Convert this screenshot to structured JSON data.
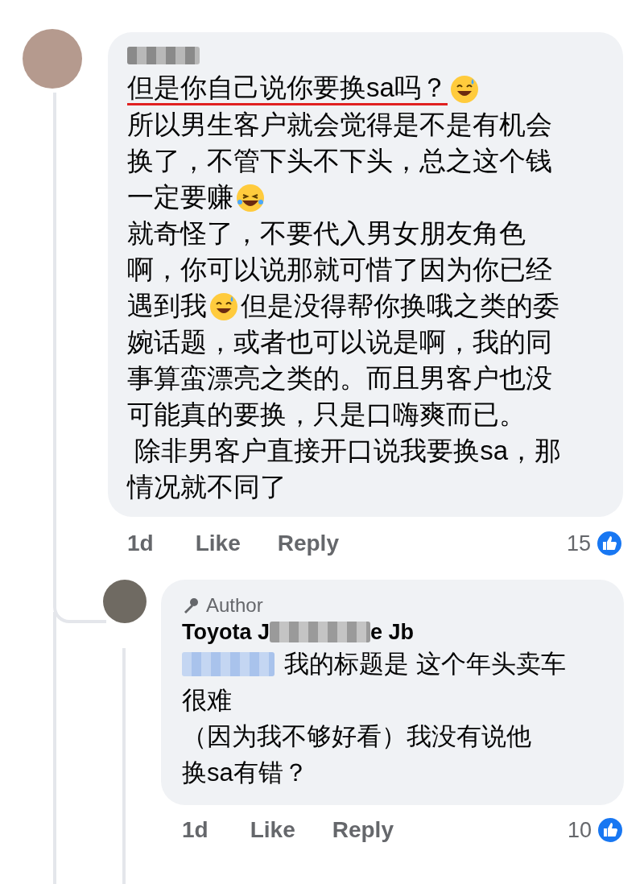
{
  "comment": {
    "body": [
      [
        {
          "kind": "text",
          "text": "但是你自己说你要换sa吗？",
          "underlined": true
        },
        {
          "kind": "emoji-sweat"
        }
      ],
      [
        {
          "kind": "text",
          "text": "所以男生客户就会觉得是不是有机会",
          "underlined": false
        }
      ],
      [
        {
          "kind": "text",
          "text": "换了，不管下头不下头，总之这个钱",
          "underlined": false
        }
      ],
      [
        {
          "kind": "text",
          "text": "一定要赚",
          "underlined": false
        },
        {
          "kind": "emoji-laugh"
        }
      ],
      [
        {
          "kind": "text",
          "text": "就奇怪了，不要代入男女朋友角色",
          "underlined": false
        }
      ],
      [
        {
          "kind": "text",
          "text": "啊，你可以说那就可惜了因为你已经",
          "underlined": false
        }
      ],
      [
        {
          "kind": "text",
          "text": "遇到我",
          "underlined": false
        },
        {
          "kind": "emoji-sweat"
        },
        {
          "kind": "text",
          "text": "但是没得帮你换哦之类的委",
          "underlined": false
        }
      ],
      [
        {
          "kind": "text",
          "text": "婉话题，或者也可以说是啊，我的同",
          "underlined": false
        }
      ],
      [
        {
          "kind": "text",
          "text": "事算蛮漂亮之类的。而且男客户也没",
          "underlined": false
        }
      ],
      [
        {
          "kind": "text",
          "text": "可能真的要换，只是口嗨爽而已。",
          "underlined": false
        }
      ],
      [
        {
          "kind": "text",
          "text": " 除非男客户直接开口说我要换sa，那",
          "underlined": false
        }
      ],
      [
        {
          "kind": "text",
          "text": "情况就不同了",
          "underlined": false
        }
      ]
    ],
    "time": "1d",
    "like": "Like",
    "reply": "Reply",
    "reaction_count": "15"
  },
  "reply": {
    "badge": "Author",
    "name_start": "Toyota J",
    "name_end": "e Jb",
    "body": [
      [
        {
          "kind": "mention"
        },
        {
          "kind": "text",
          "text": "我的标题是 这个年头卖车",
          "underlined": false
        }
      ],
      [
        {
          "kind": "text",
          "text": "很难",
          "underlined": false
        }
      ],
      [
        {
          "kind": "text",
          "text": "（因为我不够好看）我没有说他",
          "underlined": false
        }
      ],
      [
        {
          "kind": "text",
          "text": "换sa有错？",
          "underlined": false
        }
      ]
    ],
    "time": "1d",
    "like": "Like",
    "reply": "Reply",
    "reaction_count": "10"
  }
}
